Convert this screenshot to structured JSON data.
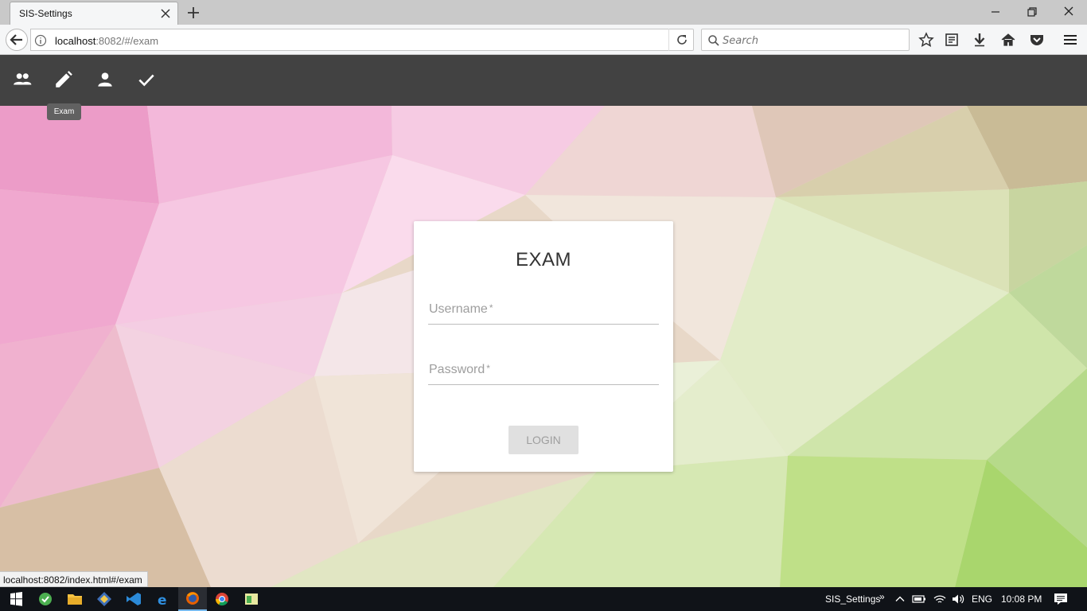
{
  "browser": {
    "tab_title": "SIS-Settings",
    "url_host": "localhost",
    "url_rest": ":8082/#/exam",
    "search_placeholder": "Search"
  },
  "app_toolbar": {
    "icons": [
      "group-icon",
      "pencil-icon",
      "person-icon",
      "check-icon"
    ],
    "tooltip": "Exam",
    "color": "#424242"
  },
  "login_card": {
    "title": "EXAM",
    "username_label": "Username",
    "password_label": "Password",
    "required_mark": "*",
    "login_label": "LOGIN"
  },
  "status_url": "localhost:8082/index.html#/exam",
  "taskbar": {
    "app_label": "SIS_Settings",
    "overflow": "»",
    "language": "ENG",
    "time": "10:08 PM"
  }
}
